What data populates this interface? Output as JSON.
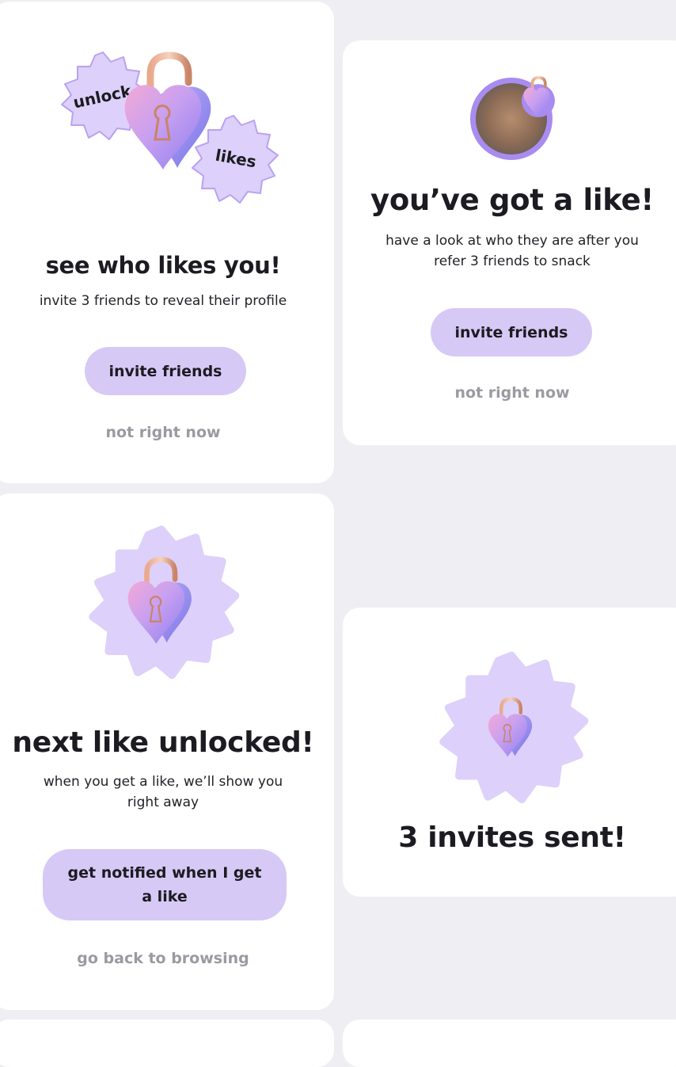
{
  "card_see_who": {
    "badge_left": "unlock",
    "badge_right": "likes",
    "title": "see who likes you!",
    "subtitle": "invite 3 friends to reveal their profile",
    "primary_button": "invite friends",
    "secondary_link": "not right now"
  },
  "card_got_like": {
    "title": "you’ve got a like!",
    "subtitle_line1": "have a look at who they are after you",
    "subtitle_line2": "refer 3 friends to snack",
    "primary_button": "invite friends",
    "secondary_link": "not right now"
  },
  "card_next_like": {
    "title": "next like unlocked!",
    "subtitle_line1": "when you get a like, we’ll show you",
    "subtitle_line2": "right away",
    "primary_button_line1": "get notified when I get",
    "primary_button_line2": "a like",
    "secondary_link": "go back to browsing"
  },
  "card_invites_sent": {
    "title": "3 invites sent!"
  },
  "colors": {
    "background": "#efeef3",
    "card": "#ffffff",
    "button": "#d7c9f6",
    "badge": "#ddd0fa",
    "muted_text": "#9a9aa0"
  }
}
